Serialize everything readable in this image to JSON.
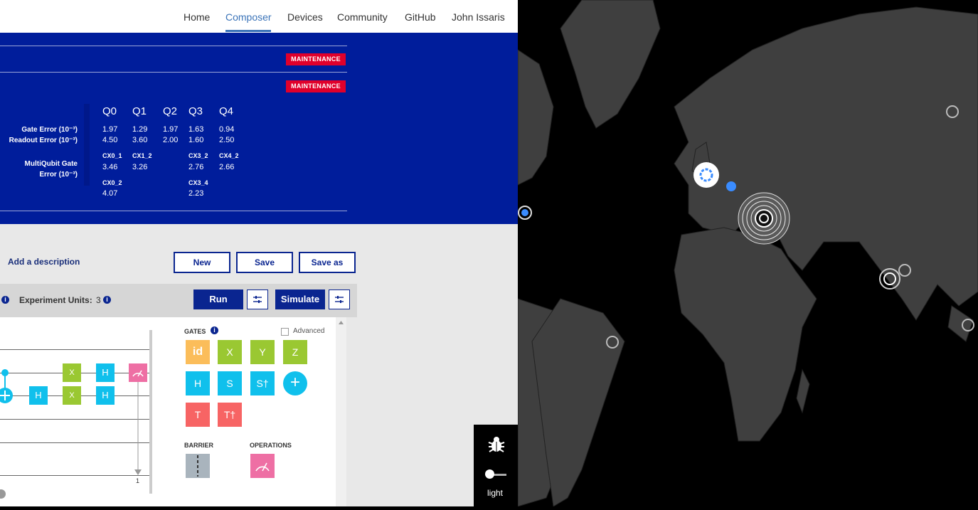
{
  "nav": {
    "items": [
      "Home",
      "Composer",
      "Devices",
      "Community",
      "GitHub",
      "John Issaris"
    ],
    "active": "Composer"
  },
  "banner": {
    "maintenance_label": "MAINTENANCE",
    "qubits": [
      "Q0",
      "Q1",
      "Q2",
      "Q3",
      "Q4"
    ],
    "gate_error_label": "Gate Error (10⁻³)",
    "readout_error_label": "Readout Error (10⁻³)",
    "multiqubit_label_1": "MultiQubit Gate",
    "multiqubit_label_2": "Error (10⁻³)",
    "gate_error": [
      "1.97",
      "1.29",
      "1.97",
      "1.63",
      "0.94"
    ],
    "readout_error": [
      "4.50",
      "3.60",
      "2.00",
      "1.60",
      "2.50"
    ],
    "cx_row1": [
      {
        "name": "CX0_1",
        "value": "3.46"
      },
      {
        "name": "CX1_2",
        "value": "3.26"
      },
      {
        "name": "CX3_2",
        "value": "2.76"
      },
      {
        "name": "CX4_2",
        "value": "2.66"
      }
    ],
    "cx_row2": [
      {
        "name": "CX0_2",
        "value": "4.07"
      },
      {
        "name": "CX3_4",
        "value": "2.23"
      }
    ]
  },
  "editor": {
    "description_placeholder": "Add a description",
    "new_label": "New",
    "save_label": "Save",
    "save_as_label": "Save as",
    "experiment_units_label": "Experiment Units:",
    "experiment_units_value": "3",
    "run_label": "Run",
    "simulate_label": "Simulate"
  },
  "palette": {
    "gates_title": "GATES",
    "advanced_label": "Advanced",
    "gates": [
      "id",
      "X",
      "Y",
      "Z",
      "H",
      "S",
      "S†",
      "+",
      "T",
      "T†"
    ],
    "barrier_title": "BARRIER",
    "operations_title": "OPERATIONS"
  },
  "circuit": {
    "gates": [
      "X",
      "H",
      "H",
      "X",
      "H"
    ],
    "measure_index": "1"
  },
  "widget": {
    "theme_label": "light"
  },
  "colors": {
    "banner": "#001d9b",
    "maintenance": "#e0002b",
    "gate_green": "#9ac832",
    "gate_cyan": "#10c0ec",
    "gate_red": "#f76464",
    "gate_orange": "#fbbd5a",
    "measure_pink": "#ee6fa4",
    "accent": "#3a73b8"
  }
}
